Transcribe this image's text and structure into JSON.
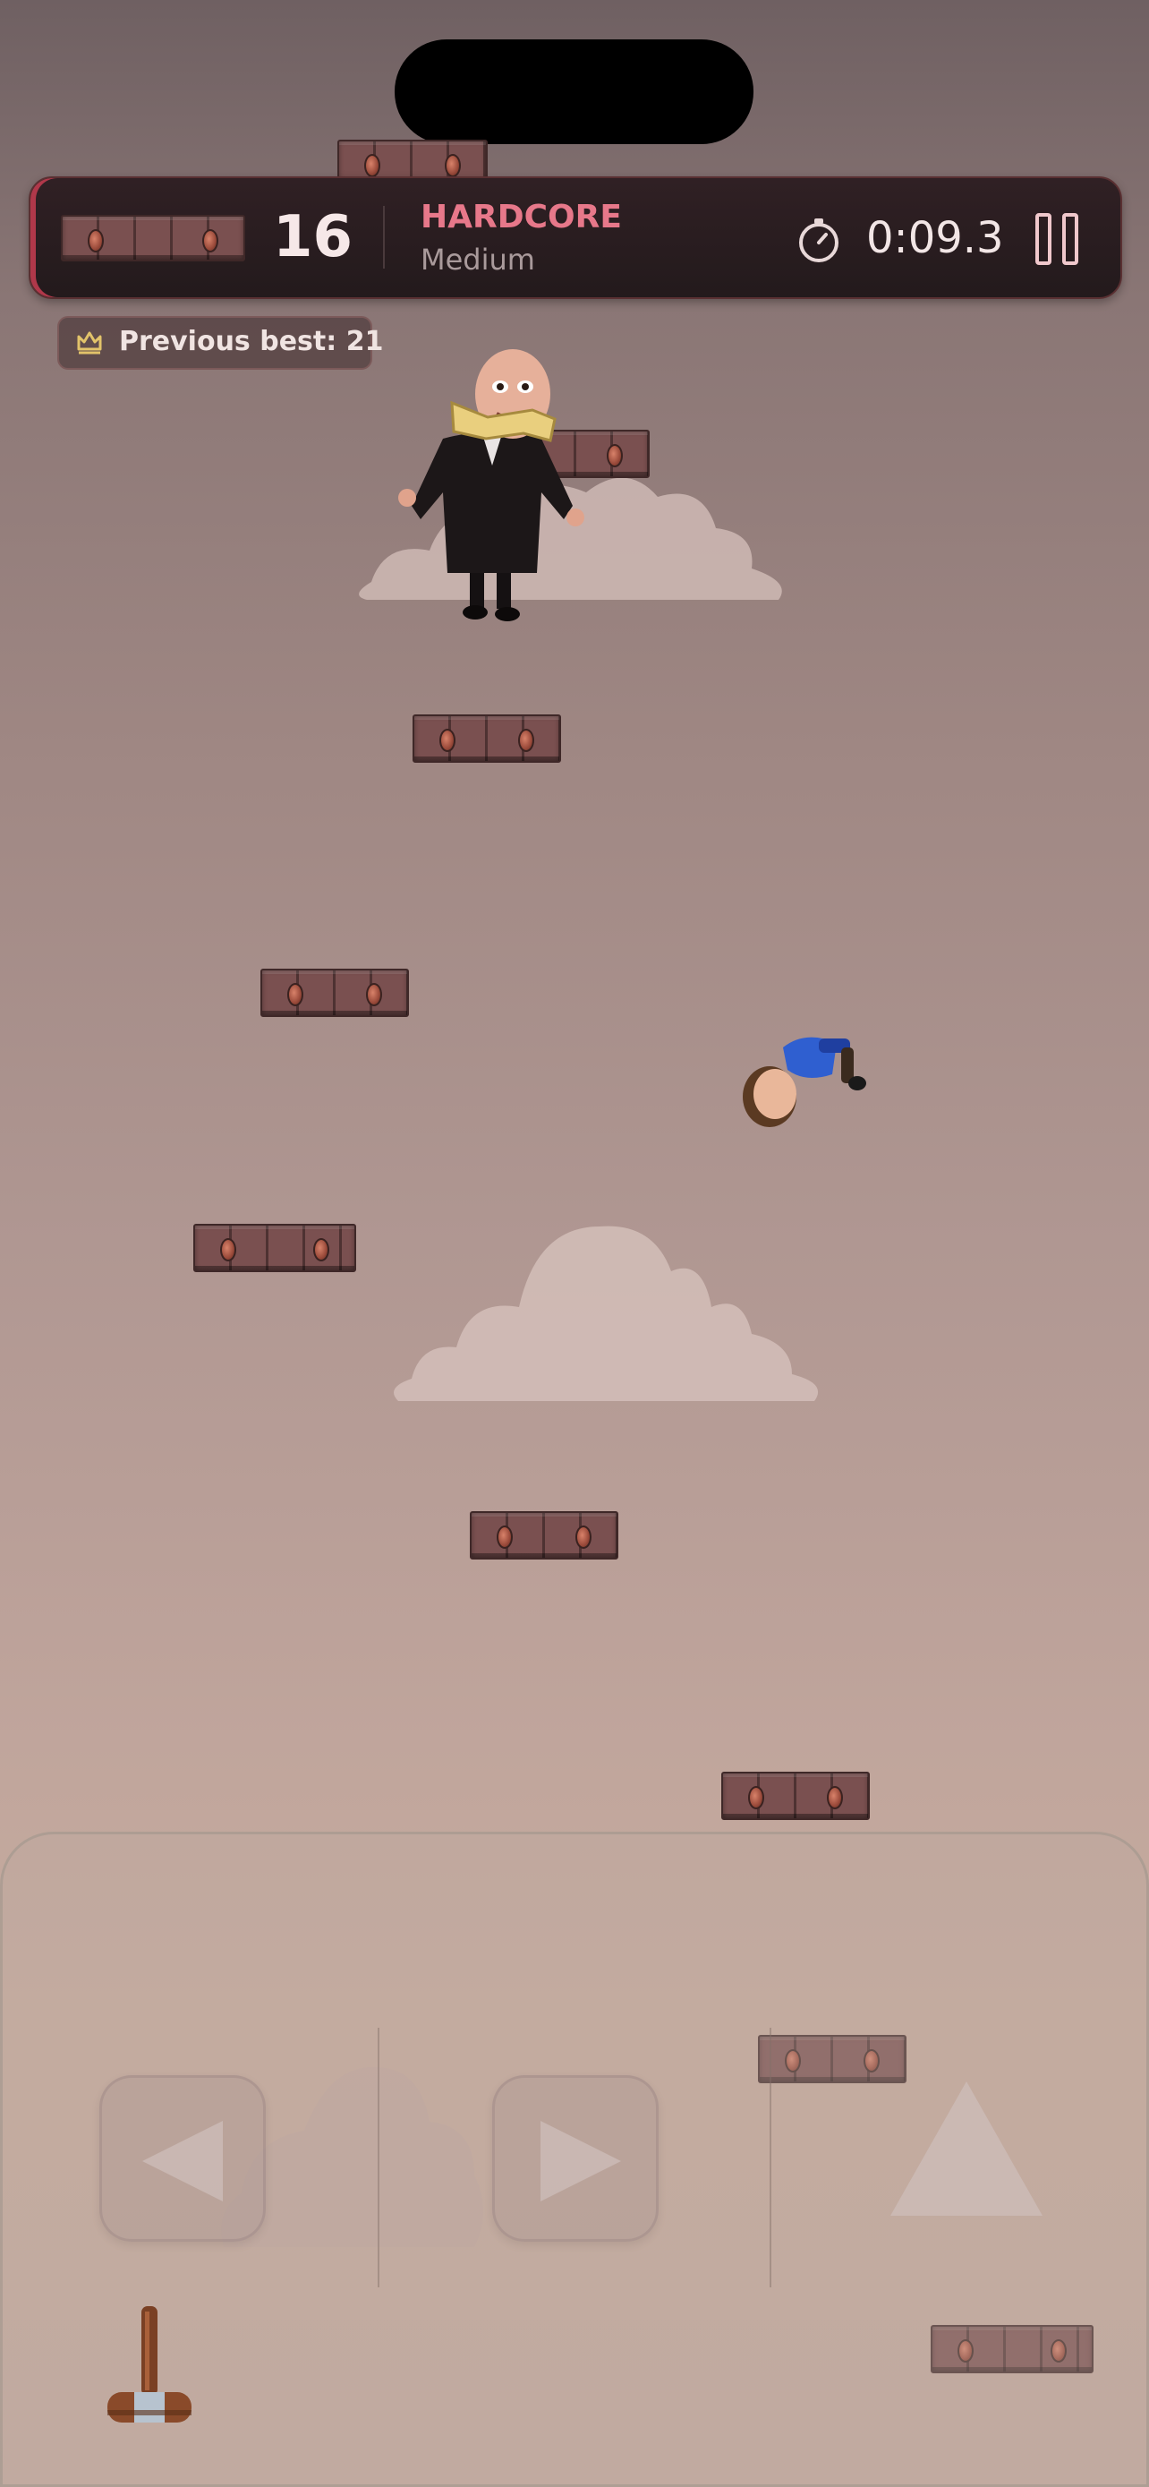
{
  "hud": {
    "score": "16",
    "mode": "HARDCORE",
    "difficulty": "Medium",
    "timer": "0:09.3",
    "previous_best": "Previous best: 21"
  },
  "icons": {
    "timer": "stopwatch-icon",
    "pause": "pause-icon",
    "best": "crown-icon",
    "left": "left-arrow-icon",
    "right": "right-arrow-icon",
    "jump": "up-triangle-icon",
    "hammer": "gavel-icon"
  },
  "colors": {
    "hud_background": "#2a1e20",
    "mode_accent": "#e7788a",
    "brick": "#6a4545"
  }
}
